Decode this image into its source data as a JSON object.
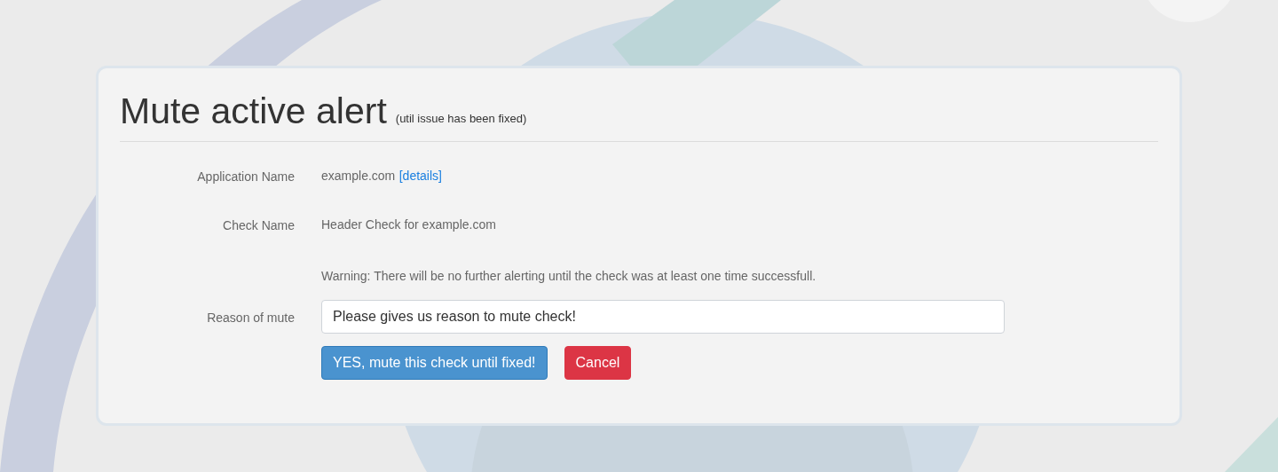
{
  "heading": {
    "title": "Mute active alert",
    "subtitle": "(util issue has been fixed)"
  },
  "fields": [
    {
      "label": "Application Name",
      "value": "example.com",
      "link": "[details]"
    },
    {
      "label": "Check Name",
      "value": "Header Check for example.com"
    }
  ],
  "warning": "Warning: There will be no further alerting until the check was at least one time successfull.",
  "reason": {
    "label": "Reason of mute",
    "value": "Please gives us reason to mute check!"
  },
  "buttons": [
    {
      "label": "YES, mute this check until fixed!",
      "kind": "primary"
    },
    {
      "label": "Cancel",
      "kind": "danger"
    }
  ]
}
